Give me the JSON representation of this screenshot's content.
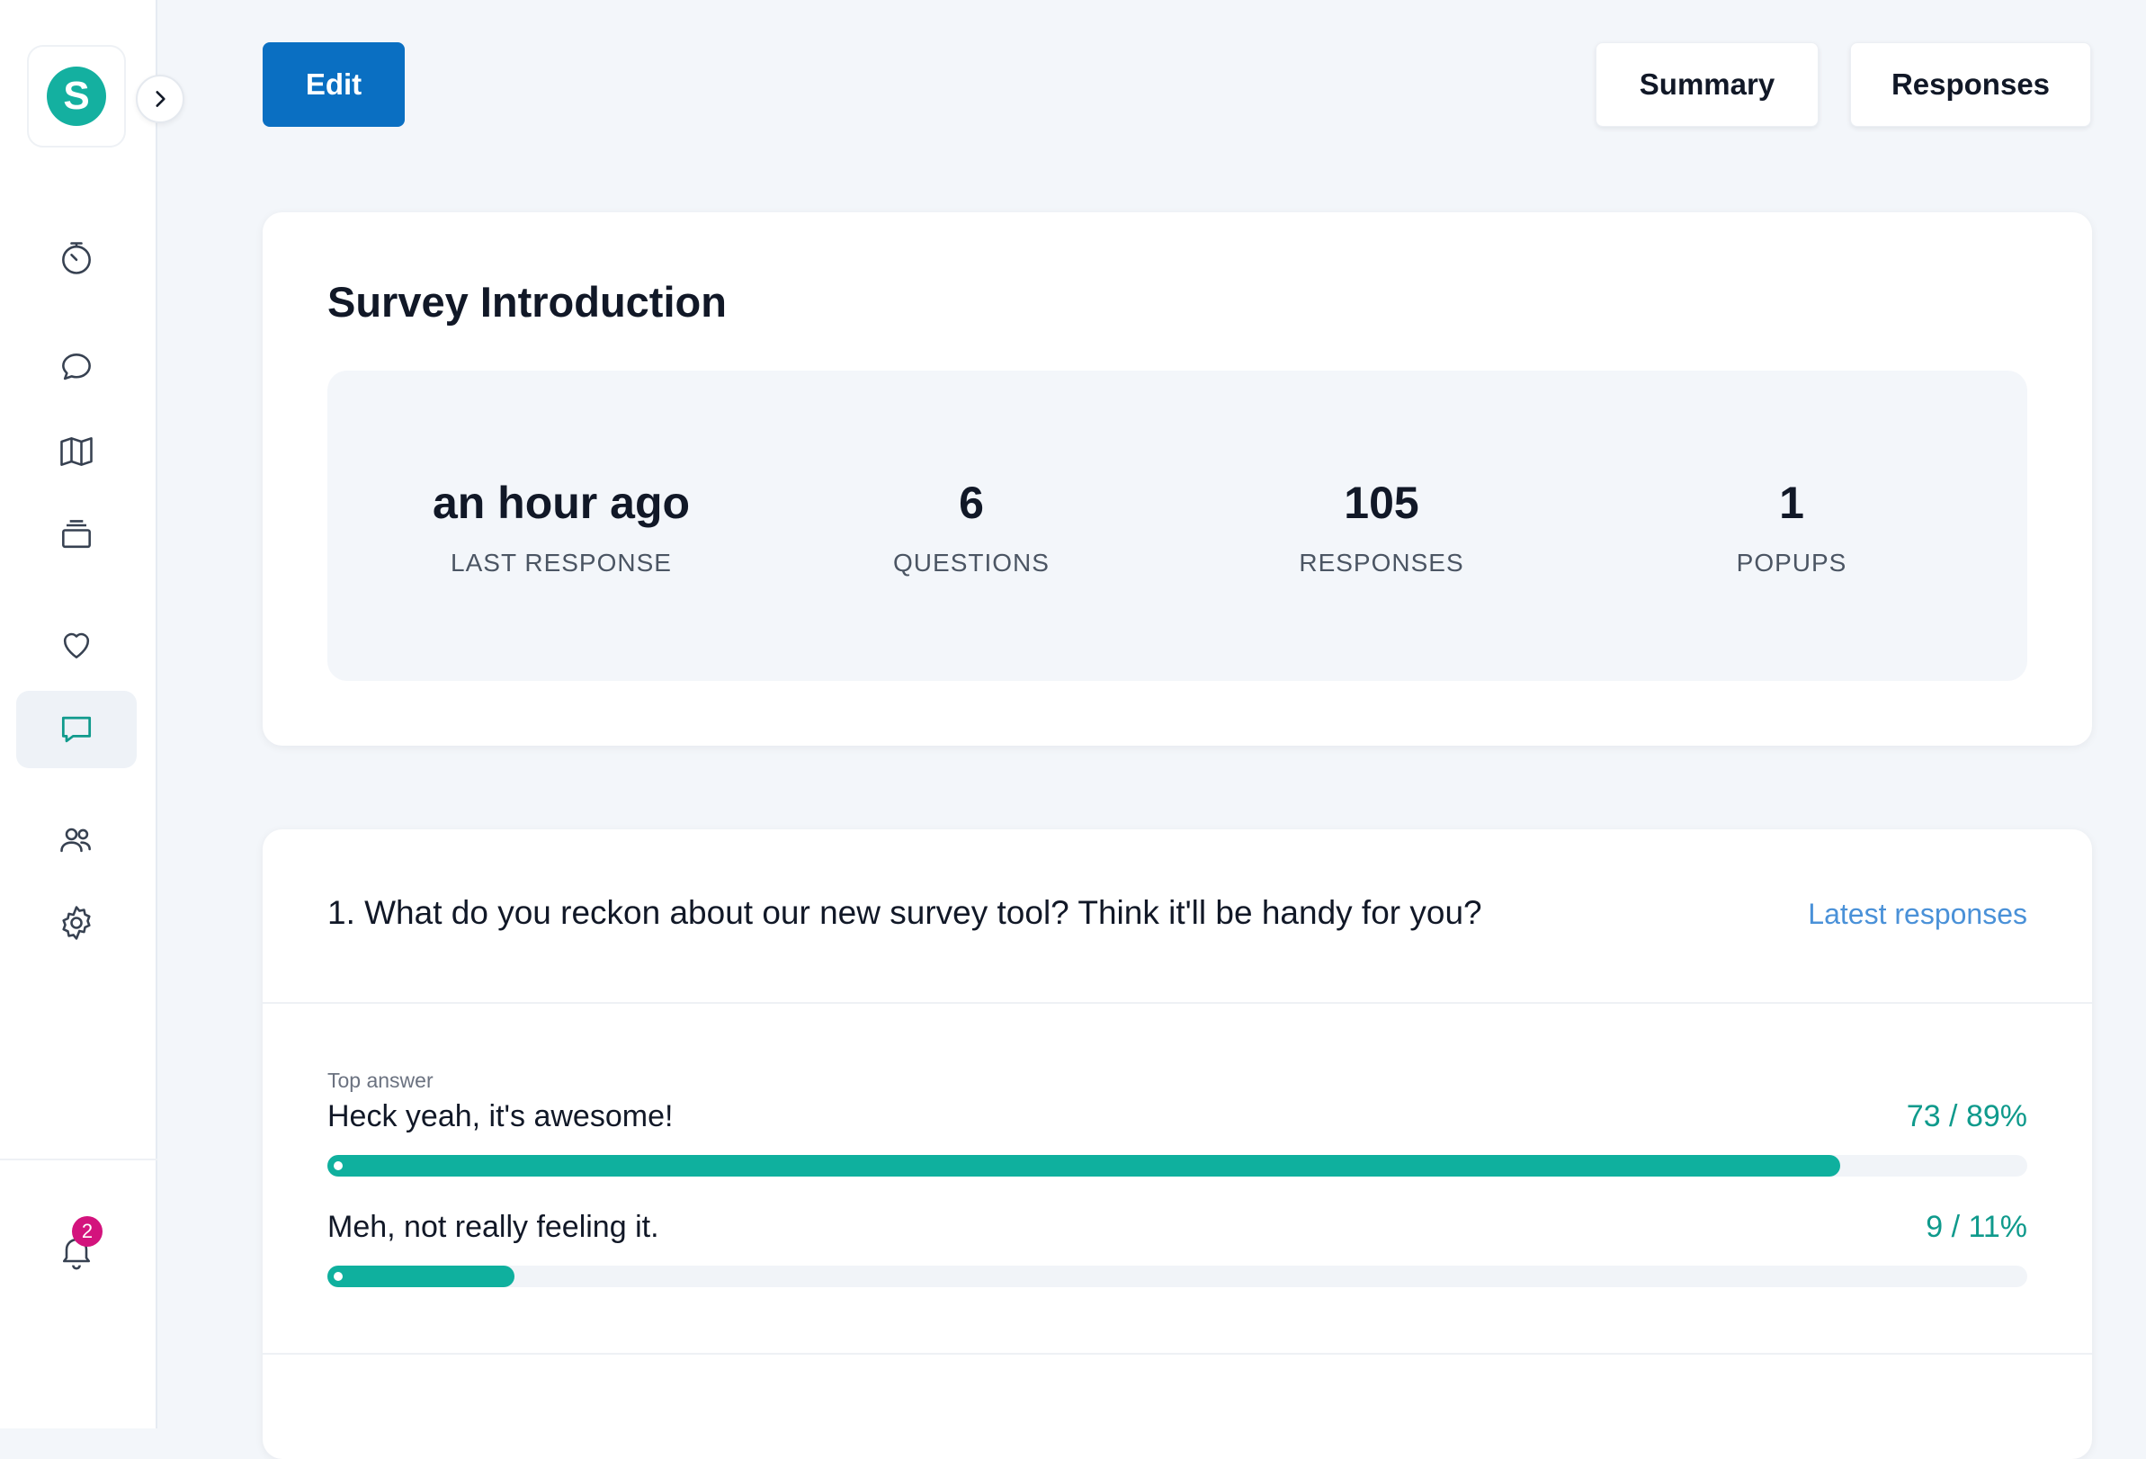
{
  "sidebar": {
    "logo_letter": "S",
    "items": [
      {
        "icon": "dashboard-timer-icon"
      },
      {
        "icon": "chat-bubbles-icon"
      },
      {
        "icon": "map-icon"
      },
      {
        "icon": "stack-icon"
      },
      {
        "icon": "heart-icon"
      },
      {
        "icon": "comment-icon",
        "active": true
      },
      {
        "icon": "users-icon"
      },
      {
        "icon": "gear-icon"
      }
    ],
    "notifications_count": "2"
  },
  "toolbar": {
    "edit_label": "Edit",
    "summary_label": "Summary",
    "responses_label": "Responses"
  },
  "intro": {
    "title": "Survey Introduction",
    "stats": [
      {
        "value": "an hour ago",
        "label": "LAST RESPONSE"
      },
      {
        "value": "6",
        "label": "QUESTIONS"
      },
      {
        "value": "105",
        "label": "RESPONSES"
      },
      {
        "value": "1",
        "label": "POPUPS"
      }
    ]
  },
  "question1": {
    "title": "1. What do you reckon about our new survey tool? Think it'll be handy for you?",
    "link": "Latest responses",
    "top_answer_label": "Top answer",
    "answers": [
      {
        "text": "Heck yeah, it's awesome!",
        "count": "73 / 89%",
        "fraction": 0.89
      },
      {
        "text": "Meh, not really feeling it.",
        "count": "9 / 11%",
        "fraction": 0.11
      }
    ]
  },
  "colors": {
    "accent": "#0a6fc2",
    "teal": "#0fb09e",
    "badge": "#d3137d",
    "link": "#4a91d8"
  }
}
